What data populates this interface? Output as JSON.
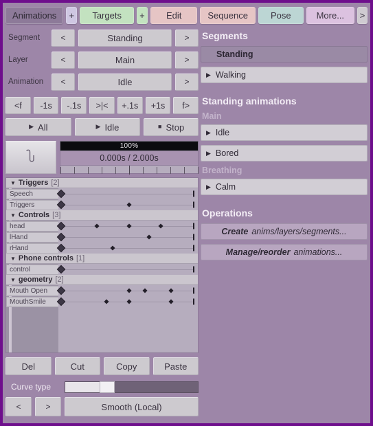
{
  "tabbar": {
    "items": [
      {
        "label": "Animations",
        "style": "active"
      },
      {
        "label": "+",
        "style": "plus"
      },
      {
        "label": "Targets",
        "style": "green"
      },
      {
        "label": "+",
        "style": "green_plus"
      },
      {
        "label": "Edit",
        "style": "pink"
      },
      {
        "label": "Sequence",
        "style": "pink"
      },
      {
        "label": "Pose",
        "style": "teal"
      },
      {
        "label": "More...",
        "style": "lilac"
      },
      {
        "label": ">",
        "style": "grey"
      }
    ]
  },
  "selectors": [
    {
      "label": "Segment",
      "prev": "<",
      "value": "Standing",
      "next": ">"
    },
    {
      "label": "Layer",
      "prev": "<",
      "value": "Main",
      "next": ">"
    },
    {
      "label": "Animation",
      "prev": "<",
      "value": "Idle",
      "next": ">"
    }
  ],
  "frame_buttons": [
    "<f",
    "-1s",
    "-.1s",
    ">|<",
    "+.1s",
    "+1s",
    "f>"
  ],
  "playback": {
    "all": "All",
    "idle": "Idle",
    "stop": "Stop",
    "play_glyph": "▶",
    "stop_glyph": "■"
  },
  "timeline": {
    "progress_label": "100%",
    "progress_percent": 100,
    "time_code": "0.000s / 2.000s",
    "curve_icon": "curve-thumbnail",
    "ruler_ticks": 11,
    "ruler_major_index": 5
  },
  "track_groups": [
    {
      "name": "Triggers",
      "count": "[2]",
      "triangle": "▼",
      "tracks": [
        {
          "name": "Speech",
          "keys": [],
          "start_key": true,
          "end_bar": true
        },
        {
          "name": "Triggers",
          "keys": [
            50.5
          ],
          "start_key": true,
          "end_bar": true
        }
      ]
    },
    {
      "name": "Controls",
      "count": "[3]",
      "triangle": "▼",
      "tracks": [
        {
          "name": "head",
          "keys": [
            27.5,
            50.5,
            73.5
          ],
          "start_key": true,
          "end_bar": true
        },
        {
          "name": "lHand",
          "keys": [
            65.0
          ],
          "start_key": true,
          "end_bar": true
        },
        {
          "name": "rHand",
          "keys": [
            39.0
          ],
          "start_key": true,
          "end_bar": true
        }
      ]
    },
    {
      "name": "Phone controls",
      "count": "[1]",
      "triangle": "▼",
      "tracks": [
        {
          "name": "control",
          "keys": [],
          "start_key": true,
          "end_bar": true
        }
      ]
    },
    {
      "name": "geometry",
      "count": "[2]",
      "triangle": "▼",
      "tracks": [
        {
          "name": "Mouth Open",
          "keys": [
            50.5,
            62.0,
            81.0
          ],
          "start_key": true,
          "end_bar": true
        },
        {
          "name": "MouthSmile",
          "keys": [
            34.5,
            50.5,
            81.0
          ],
          "start_key": true,
          "end_bar": true
        }
      ]
    }
  ],
  "edit_buttons": [
    "Del",
    "Cut",
    "Copy",
    "Paste"
  ],
  "curve_type": {
    "label": "Curve type",
    "slider_value": 28,
    "prev": "<",
    "next": ">",
    "value": "Smooth (Local)"
  },
  "segments": {
    "title": "Segments",
    "items": [
      {
        "label": "Standing",
        "selected": true,
        "triangle": ""
      },
      {
        "label": "Walking",
        "selected": false,
        "triangle": "▶"
      }
    ]
  },
  "animations": {
    "title": "Standing animations",
    "layers": [
      {
        "name": "Main",
        "items": [
          {
            "label": "Idle",
            "triangle": "▶"
          },
          {
            "label": "Bored",
            "triangle": "▶"
          }
        ]
      },
      {
        "name": "Breathing",
        "items": [
          {
            "label": "Calm",
            "triangle": "▶"
          }
        ]
      }
    ]
  },
  "operations": {
    "title": "Operations",
    "items": [
      {
        "bold": "Create",
        "rest": "anims/layers/segments..."
      },
      {
        "bold": "Manage/reorder",
        "rest": "animations..."
      }
    ]
  }
}
